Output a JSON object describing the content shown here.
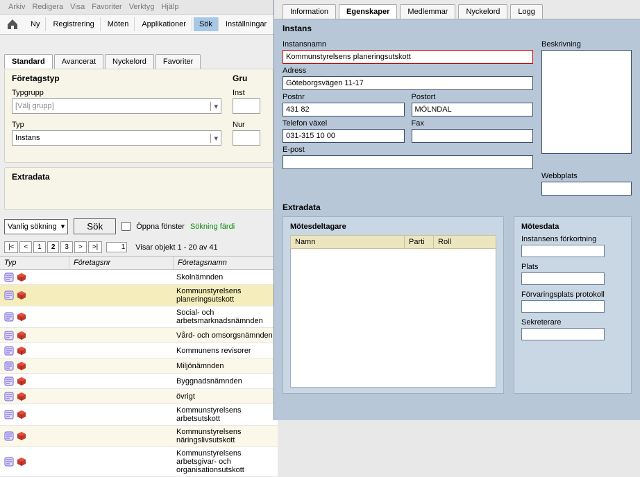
{
  "menubar": [
    "Arkiv",
    "Redigera",
    "Visa",
    "Favoriter",
    "Verktyg",
    "Hjälp"
  ],
  "toolbar": {
    "items": [
      "Ny",
      "Registrering",
      "Möten",
      "Applikationer",
      "Sök",
      "Inställningar"
    ],
    "active": "Sök"
  },
  "searchTabs": {
    "items": [
      "Standard",
      "Avancerat",
      "Nyckelord",
      "Favoriter"
    ],
    "active": "Standard"
  },
  "form": {
    "foretagstyp": "Företagstyp",
    "typgrupp_label": "Typgrupp",
    "typgrupp_value": "[Välj grupp]",
    "typ_label": "Typ",
    "typ_value": "Instans",
    "gru_label": "Gru",
    "inst_label": "Inst",
    "num_label": "Nur"
  },
  "extradata_label": "Extradata",
  "searchbar": {
    "mode": "Vanlig sökning",
    "button": "Sök",
    "open_windows": "Öppna fönster",
    "status": "Sökning färdi"
  },
  "pager": {
    "text": "Visar objekt 1 - 20 av 41",
    "current_input": "1",
    "buttons": [
      "|<",
      "<",
      "1",
      "2",
      "3",
      ">",
      ">|"
    ],
    "current": "2"
  },
  "grid": {
    "cols": [
      "Typ",
      "Företagsnr",
      "Företagsnamn"
    ],
    "rows": [
      {
        "name": "Skolnämnden"
      },
      {
        "name": "Kommunstyrelsens planeringsutskott",
        "selected": true
      },
      {
        "name": "Social- och arbetsmarknadsnämnden"
      },
      {
        "name": "Vård- och omsorgsnämnden"
      },
      {
        "name": "Kommunens revisorer"
      },
      {
        "name": "Miljönämnden"
      },
      {
        "name": "Byggnadsnämnden"
      },
      {
        "name": "övrigt"
      },
      {
        "name": "Kommunstyrelsens arbetsutskott"
      },
      {
        "name": "Kommunstyrelsens näringslivsutskott"
      },
      {
        "name": "Kommunstyrelsens arbetsgivar- och organisationsutskott"
      }
    ]
  },
  "detailTabs": {
    "items": [
      "Information",
      "Egenskaper",
      "Medlemmar",
      "Nyckelord",
      "Logg"
    ],
    "active": "Egenskaper"
  },
  "instans": {
    "section": "Instans",
    "instansnamn_label": "Instansnamn",
    "instansnamn": "Kommunstyrelsens planeringsutskott",
    "adress_label": "Adress",
    "adress": "Göteborgsvägen 11-17",
    "postnr_label": "Postnr",
    "postnr": "431 82",
    "postort_label": "Postort",
    "postort": "MÖLNDAL",
    "tel_label": "Telefon växel",
    "tel": "031-315 10 00",
    "fax_label": "Fax",
    "fax": "",
    "epost_label": "E-post",
    "epost": "",
    "beskrivning_label": "Beskrivning",
    "webb_label": "Webbplats"
  },
  "motesdeltagare": {
    "title": "Mötesdeltagare",
    "cols": [
      "Namn",
      "Parti",
      "Roll"
    ]
  },
  "motesdata": {
    "title": "Mötesdata",
    "fields": [
      "Instansens förkortning",
      "Plats",
      "Förvaringsplats protokoll",
      "Sekreterare"
    ]
  }
}
